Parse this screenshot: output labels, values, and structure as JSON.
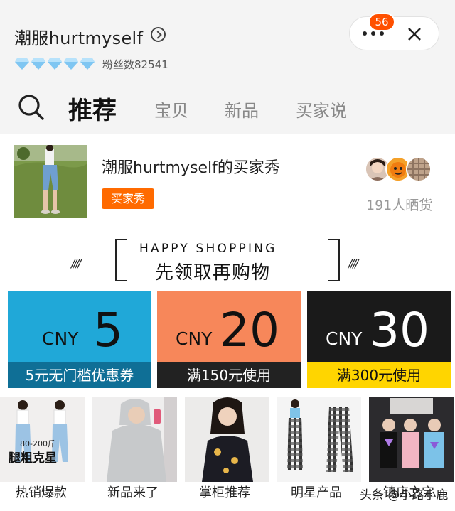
{
  "shop": {
    "name": "潮服hurtmyself",
    "fans": "粉丝数82541",
    "diamond_count": 5,
    "notification_badge": "56"
  },
  "tabs": [
    {
      "label": "推荐",
      "active": true
    },
    {
      "label": "宝贝",
      "active": false
    },
    {
      "label": "新品",
      "active": false
    },
    {
      "label": "买家说",
      "active": false
    }
  ],
  "buyer_show": {
    "title": "潮服hurtmyself的买家秀",
    "tag": "买家秀",
    "count": "191人晒货"
  },
  "banner": {
    "english": "HAPPY SHOPPING",
    "chinese": "先领取再购物",
    "slashes": "////"
  },
  "coupons": [
    {
      "currency": "CNY",
      "amount": "5",
      "condition": "5元无门槛优惠券",
      "colors": {
        "bg": "#20a8d8",
        "bar": "#0f6f96",
        "text": "#ffffff"
      }
    },
    {
      "currency": "CNY",
      "amount": "20",
      "condition": "满150元使用",
      "colors": {
        "bg": "#f7875a",
        "bar": "#222222",
        "text": "#ffffff"
      }
    },
    {
      "currency": "CNY",
      "amount": "30",
      "condition": "满300元使用",
      "colors": {
        "bg": "#1a1a1a",
        "bar": "#ffd500",
        "text": "#111111"
      }
    }
  ],
  "colors": {
    "accent": "#ff5000",
    "tag": "#ff6a00",
    "diamond": "#7fc6f2"
  },
  "categories": [
    {
      "label": "热销爆款",
      "image_text": "腿粗克星",
      "image_subtext": "80-200斤"
    },
    {
      "label": "新品来了"
    },
    {
      "label": "掌柜推荐"
    },
    {
      "label": "明星产品"
    },
    {
      "label": "镇店之宝"
    }
  ],
  "watermark": "头条 @小路小鹿"
}
